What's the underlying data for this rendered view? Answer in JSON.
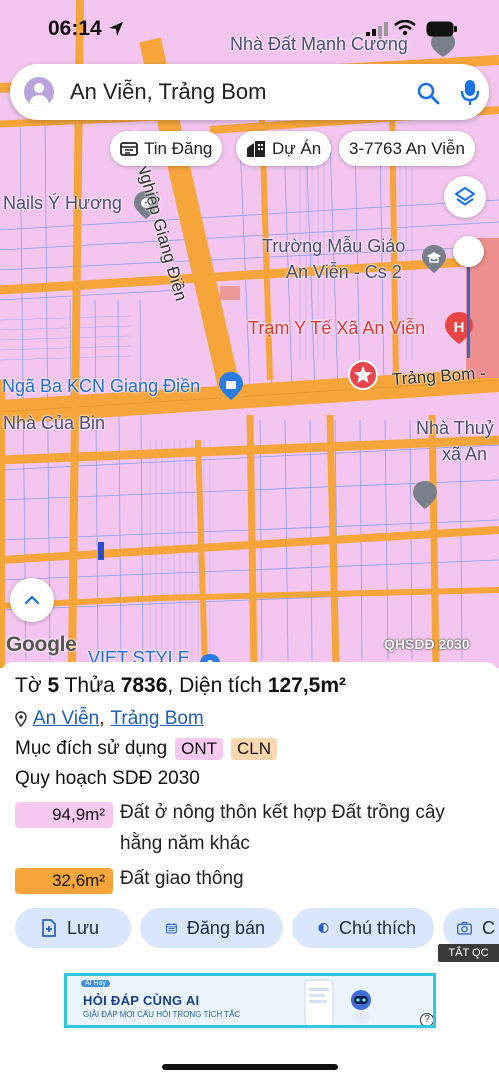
{
  "status_bar": {
    "time": "06:14"
  },
  "map": {
    "labels": {
      "nha_dat": "Nhà Đất Mạnh Cường",
      "nails": "Nails Ý Hương",
      "truong_1": "Trường Mẫu Giáo",
      "truong_2": "An Viễn - Cs 2",
      "tram_y_te": "Trạm Y Tế Xã An Viễn",
      "nga_ba": "Ngã Ba KCN Giang Điền",
      "trang_bom_road": "Trảng Bom -",
      "nha_cua_bin": "Nhà Của Bin",
      "nha_thuy_1": "Nhà Thuỷ",
      "nha_thuy_2": "xã An",
      "road_vertical": "ông Nghiệp Giang Điền",
      "viet_style": "VIET STYLE"
    },
    "google_logo": "Google",
    "source": "QHSDĐ 2030"
  },
  "search": {
    "text": "An Viễn, Trảng Bom"
  },
  "chips": {
    "tin_dang": "Tin Đăng",
    "du_an": "Dự Án",
    "parcel": "3-7763 An Viễn"
  },
  "parcel": {
    "prefix_to": "Tờ",
    "to": "5",
    "prefix_thua": "Thửa",
    "thua": "7836",
    "prefix_area": ", Diện tích",
    "area": "127,5m²",
    "ward": "An Viễn",
    "separator": ",",
    "district": "Trảng Bom",
    "purpose_label": "Mục đích sử dụng",
    "tag_ont": "ONT",
    "tag_cln": "CLN",
    "plan_label": "Quy hoạch SDĐ 2030",
    "land_uses": [
      {
        "area": "94,9m²",
        "description": "Đất ở nông thôn kết hợp Đất trồng cây hằng năm khác"
      },
      {
        "area": "32,6m²",
        "description": "Đất giao thông"
      }
    ]
  },
  "actions": {
    "save": "Lưu",
    "post": "Đăng bán",
    "legend": "Chú thích",
    "capture": "C"
  },
  "ad": {
    "close_label": "TẮT QC",
    "brand": "AI Hay",
    "headline": "HỎI ĐÁP CÙNG AI",
    "subline": "GIẢI ĐÁP MỌI CÂU HỎI TRONG TÍCH TẮC",
    "info": "?"
  },
  "colors": {
    "land_residential": "#f7c8f0",
    "land_road": "#f5a53a",
    "road": "#f5a53a",
    "accent": "#1a73e8",
    "action_bg": "#d9e6fb"
  }
}
